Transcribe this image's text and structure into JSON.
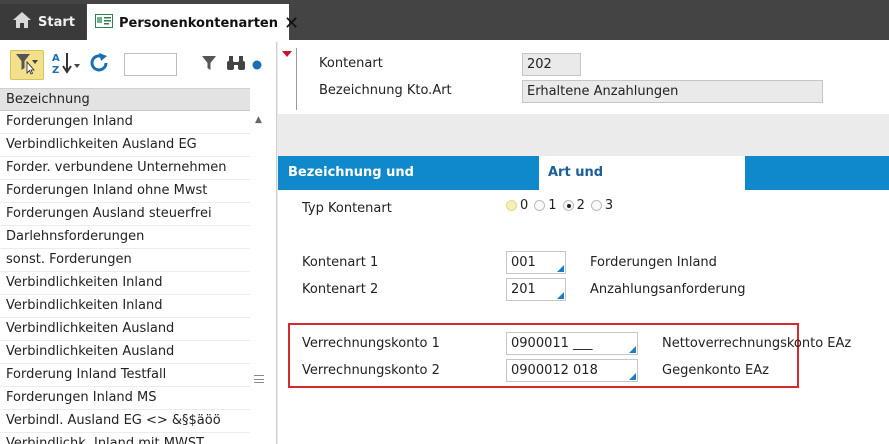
{
  "tabs": {
    "start_label": "Start",
    "active_label": "Personenkontenarten"
  },
  "icons": {
    "home": "home-icon",
    "card": "card-icon",
    "close": "close-icon",
    "filter": "filter-icon",
    "sort": "sort-az-icon",
    "refresh": "refresh-icon",
    "search": "binoculars-icon"
  },
  "colors": {
    "accent": "#1089cc",
    "highlight_box": "#d62b2b",
    "filter_active": "#f3e08c"
  },
  "list": {
    "header": "Bezeichnung",
    "items": [
      "Forderungen Inland",
      "Verbindlichkeiten Ausland EG",
      "Forder. verbundene Unternehmen",
      "Forderungen Inland ohne Mwst",
      "Forderungen Ausland steuerfrei",
      "Darlehnsforderungen",
      "sonst. Forderungen",
      "Verbindlichkeiten Inland",
      "Verbindlichkeiten Inland",
      "Verbindlichkeiten Ausland",
      "Verbindlichkeiten Ausland",
      "Forderung Inland Testfall",
      "Forderungen Inland MS",
      "Verbindl. Ausland EG <> &§$äöö",
      "Verbindlichk. Inland mit MWST"
    ]
  },
  "header": {
    "kontenart_label": "Kontenart",
    "kontenart_value": "202",
    "bezeichnung_label": "Bezeichnung Kto.Art",
    "bezeichnung_value": "Erhaltene Anzahlungen"
  },
  "detail_tabs": {
    "tab1": "Bezeichnung und Sachkontonummer",
    "tab2": "Art und Verrechnungskonten"
  },
  "form": {
    "typ_label": "Typ Kontenart",
    "typ_options": [
      "0",
      "1",
      "2",
      "3"
    ],
    "typ_selected": "2",
    "kontenart1_label": "Kontenart 1",
    "kontenart1_value": "001",
    "kontenart1_desc": "Forderungen Inland",
    "kontenart2_label": "Kontenart 2",
    "kontenart2_value": "201",
    "kontenart2_desc": "Anzahlungsanforderung",
    "verrechnung1_label": "Verrechnungskonto 1",
    "verrechnung1_value": "0900011 ___",
    "verrechnung1_desc": "Nettoverrechnungskonto EAz",
    "verrechnung2_label": "Verrechnungskonto 2",
    "verrechnung2_value": "0900012 018",
    "verrechnung2_desc": "Gegenkonto EAz"
  }
}
